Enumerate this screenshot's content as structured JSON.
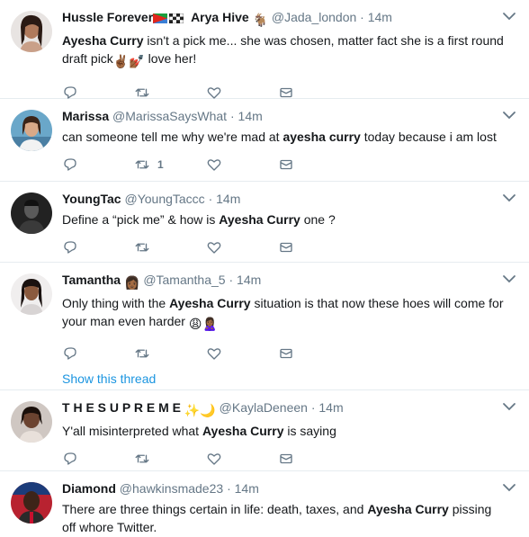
{
  "tweets": [
    {
      "name": "Hussle Forever",
      "name_part2": "Arya Hive",
      "handle": "@Jada_london",
      "time": "14m",
      "text_pre": "",
      "highlight": "Ayesha Curry",
      "text_post": " isn't a pick me... she was chosen, matter fact she is a first round draft pick",
      "text_end": " love her!",
      "replies": "",
      "retweets": "",
      "likes": ""
    },
    {
      "name": "Marissa",
      "handle": "@MarissaSaysWhat",
      "time": "14m",
      "text_pre": "can someone tell me why we're mad at ",
      "highlight": "ayesha curry",
      "text_post": " today because i am lost",
      "replies": "",
      "retweets": "1",
      "likes": ""
    },
    {
      "name": "YoungTac",
      "handle": "@YoungTaccc",
      "time": "14m",
      "text_pre": "Define a “pick me” & how is ",
      "highlight": "Ayesha Curry",
      "text_post": " one ?",
      "replies": "",
      "retweets": "",
      "likes": ""
    },
    {
      "name": "Tamantha",
      "handle": "@Tamantha_5",
      "time": "14m",
      "text_pre": "Only thing with the ",
      "highlight": "Ayesha Curry",
      "text_post": " situation is that now these hoes will come for your man even harder",
      "replies": "",
      "retweets": "",
      "likes": "",
      "show_thread": "Show this thread"
    },
    {
      "name": "T H E S U P R E M E",
      "handle": "@KaylaDeneen",
      "time": "14m",
      "text_pre": "Y'all misinterpreted what ",
      "highlight": "Ayesha Curry",
      "text_post": " is saying",
      "replies": "",
      "retweets": "",
      "likes": ""
    },
    {
      "name": "Diamond",
      "handle": "@hawkinsmade23",
      "time": "14m",
      "text_pre": "There are three things certain in life: death, taxes, and ",
      "highlight": "Ayesha Curry",
      "text_post": " pissing off whore Twitter.",
      "replies": "",
      "retweets": "",
      "likes": ""
    }
  ],
  "separator": "·",
  "colors": {
    "meta": "#657786",
    "link": "#1b95e0",
    "border": "#e6ecf0"
  },
  "icons": [
    "reply-icon",
    "retweet-icon",
    "like-icon",
    "dm-icon",
    "caret-down-icon"
  ]
}
